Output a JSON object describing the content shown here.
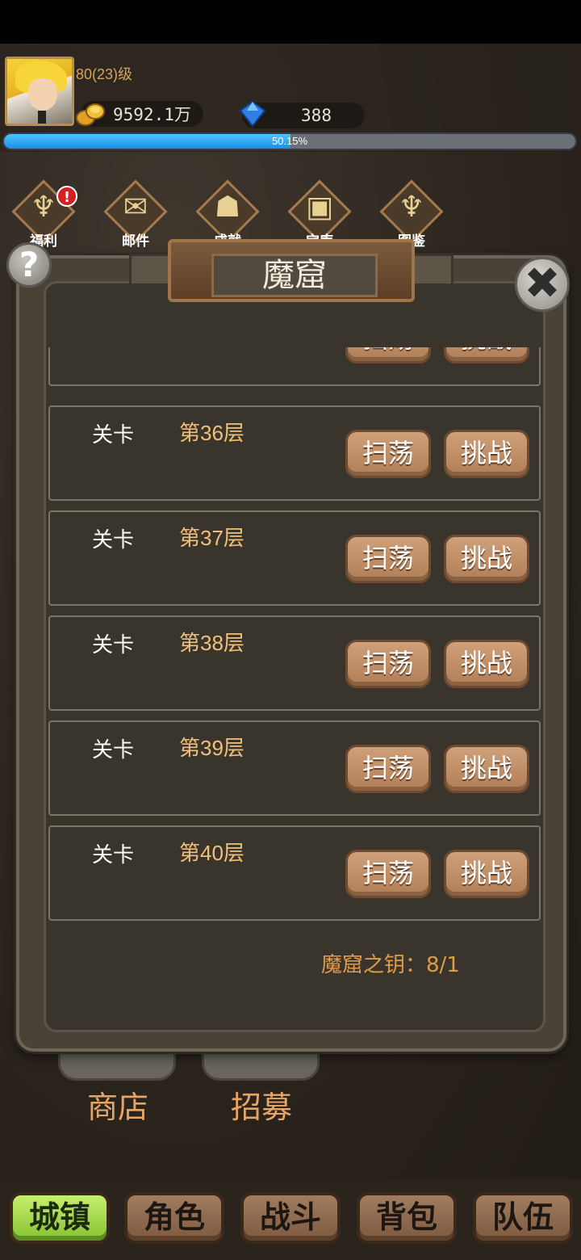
{
  "header": {
    "level": "80(23)级",
    "gold": "9592.1万",
    "gems": "388",
    "xp_text": "50.15%",
    "xp_fraction": 0.5015
  },
  "top_icons": [
    {
      "label": "福利",
      "badge": "!"
    },
    {
      "label": "邮件"
    },
    {
      "label": "成就"
    },
    {
      "label": "宝库"
    },
    {
      "label": "图鉴"
    }
  ],
  "background_buttons": {
    "shop": "商店",
    "recruit": "招募"
  },
  "dialog": {
    "title": "魔窟",
    "help_glyph": "?",
    "close_glyph": "✖",
    "stage_label": "关卡",
    "sweep_label": "扫荡",
    "challenge_label": "挑战",
    "floors": [
      "第36层",
      "第37层",
      "第38层",
      "第39层",
      "第40层"
    ],
    "key_text": "魔窟之钥：8/1"
  },
  "nav": {
    "town": "城镇",
    "character": "角色",
    "battle": "战斗",
    "bag": "背包",
    "team": "队伍"
  },
  "colors": {
    "accent_gold": "#e19a45",
    "xp_blue": "#1a8ee6",
    "nav_active": "#86c233"
  }
}
